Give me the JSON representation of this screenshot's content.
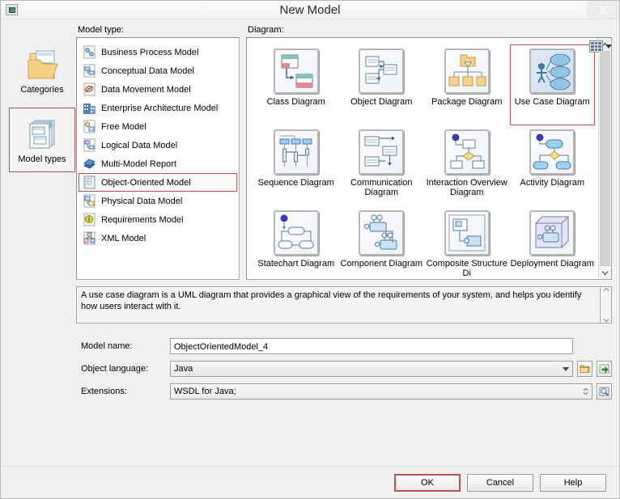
{
  "window": {
    "title": "New Model",
    "app_icon": "application-icon",
    "close_label": "close-icon"
  },
  "rail": {
    "items": [
      {
        "label": "Categories",
        "icon": "categories-folder-icon",
        "selected": false
      },
      {
        "label": "Model types",
        "icon": "model-types-icon",
        "selected": true
      }
    ]
  },
  "model_type": {
    "header": "Model type:",
    "items": [
      {
        "label": "Business Process Model",
        "icon": "business-process-model-icon",
        "selected": false
      },
      {
        "label": "Conceptual Data Model",
        "icon": "conceptual-data-model-icon",
        "selected": false
      },
      {
        "label": "Data Movement Model",
        "icon": "data-movement-model-icon",
        "selected": false
      },
      {
        "label": "Enterprise Architecture Model",
        "icon": "enterprise-architecture-model-icon",
        "selected": false
      },
      {
        "label": "Free Model",
        "icon": "free-model-icon",
        "selected": false
      },
      {
        "label": "Logical Data Model",
        "icon": "logical-data-model-icon",
        "selected": false
      },
      {
        "label": "Multi-Model Report",
        "icon": "multi-model-report-icon",
        "selected": false
      },
      {
        "label": "Object-Oriented Model",
        "icon": "object-oriented-model-icon",
        "selected": true
      },
      {
        "label": "Physical Data Model",
        "icon": "physical-data-model-icon",
        "selected": false
      },
      {
        "label": "Requirements Model",
        "icon": "requirements-model-icon",
        "selected": false
      },
      {
        "label": "XML Model",
        "icon": "xml-model-icon",
        "selected": false
      }
    ]
  },
  "diagram": {
    "header": "Diagram:",
    "view_toggle": {
      "icon": "grid-view-icon",
      "caret": "chevron-down-icon"
    },
    "items": [
      {
        "label": "Class Diagram",
        "icon": "class-diagram-icon",
        "selected": false
      },
      {
        "label": "Object Diagram",
        "icon": "object-diagram-icon",
        "selected": false
      },
      {
        "label": "Package Diagram",
        "icon": "package-diagram-icon",
        "selected": false
      },
      {
        "label": "Use Case Diagram",
        "icon": "use-case-diagram-icon",
        "selected": true
      },
      {
        "label": "Sequence Diagram",
        "icon": "sequence-diagram-icon",
        "selected": false
      },
      {
        "label": "Communication Diagram",
        "icon": "communication-diagram-icon",
        "selected": false
      },
      {
        "label": "Interaction Overview Diagram",
        "icon": "interaction-overview-diagram-icon",
        "selected": false
      },
      {
        "label": "Activity Diagram",
        "icon": "activity-diagram-icon",
        "selected": false
      },
      {
        "label": "Statechart Diagram",
        "icon": "statechart-diagram-icon",
        "selected": false
      },
      {
        "label": "Component Diagram",
        "icon": "component-diagram-icon",
        "selected": false
      },
      {
        "label": "Composite Structure Di",
        "icon": "composite-structure-diagram-icon",
        "selected": false
      },
      {
        "label": "Deployment Diagram",
        "icon": "deployment-diagram-icon",
        "selected": false
      }
    ],
    "scrollbar": {
      "up": "scroll-up-icon",
      "down": "scroll-down-icon"
    }
  },
  "description": {
    "text": "A use case diagram is a UML diagram that provides a graphical view of the requirements of your system, and helps you identify how users interact with it."
  },
  "form": {
    "model_name": {
      "label": "Model name:",
      "value": "ObjectOrientedModel_4"
    },
    "object_language": {
      "label": "Object language:",
      "value": "Java",
      "browse_icon": "folder-open-icon",
      "import_icon": "green-arrow-import-icon"
    },
    "extensions": {
      "label": "Extensions:",
      "value": "WSDL for Java;",
      "properties_icon": "magnifier-properties-icon"
    }
  },
  "footer": {
    "ok": "OK",
    "cancel": "Cancel",
    "help": "Help"
  },
  "colors": {
    "selection_red": "#c0504d",
    "window_bg": "#f0f0f0",
    "panel_bg": "#ffffff",
    "icon_blue": "#4a7ab0"
  }
}
